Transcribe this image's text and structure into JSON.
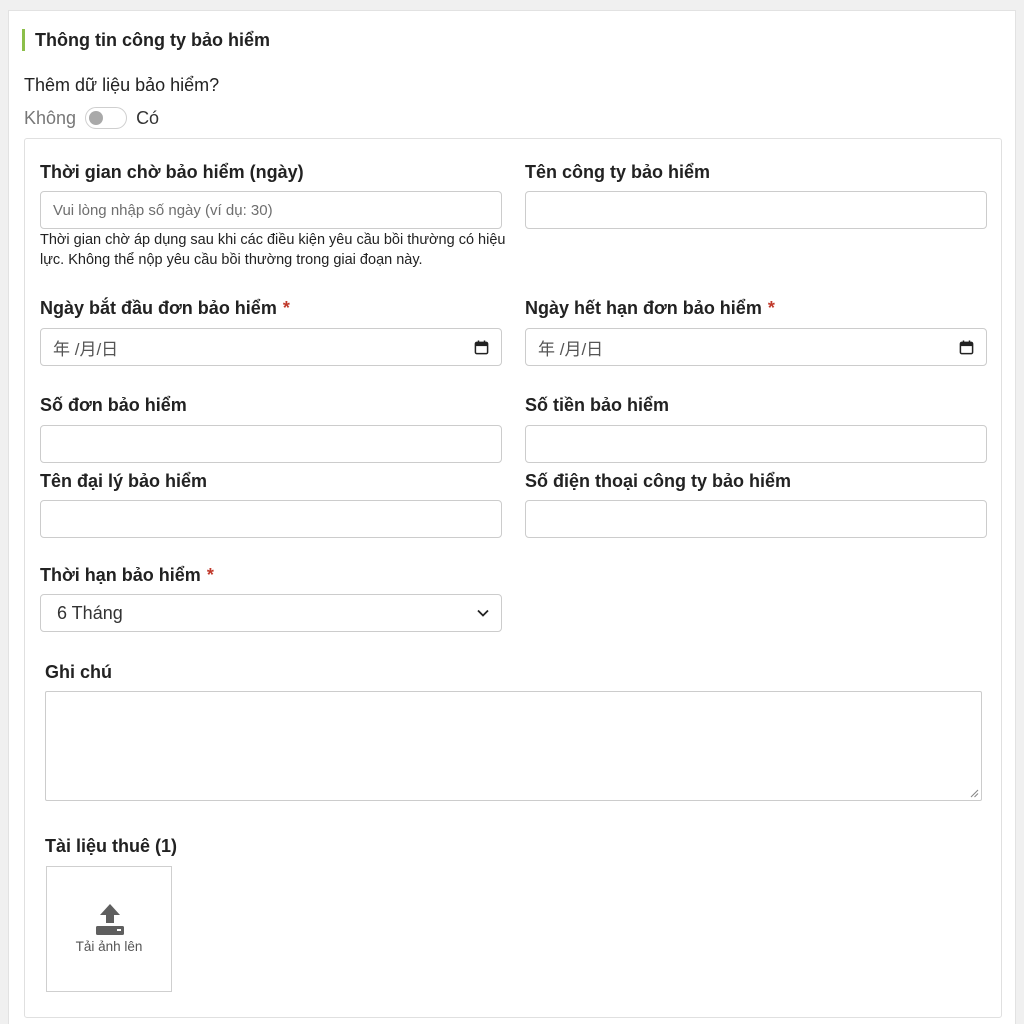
{
  "section": {
    "title": "Thông tin công ty bảo hiểm"
  },
  "toggle": {
    "question": "Thêm dữ liệu bảo hiểm?",
    "off_label": "Không",
    "on_label": "Có",
    "checked": false
  },
  "fields": {
    "waiting_period": {
      "label": "Thời gian chờ bảo hiểm (ngày)",
      "placeholder": "Vui lòng nhập số ngày (ví dụ: 30)",
      "help": "Thời gian chờ áp dụng sau khi các điều kiện yêu cầu bồi thường có hiệu lực. Không thể nộp yêu cầu bồi thường trong giai đoạn này."
    },
    "insurer_name": {
      "label": "Tên công ty bảo hiểm",
      "value": ""
    },
    "start_date": {
      "label": "Ngày bắt đầu đơn bảo hiểm",
      "required": "*",
      "display": "年 /月/日"
    },
    "end_date": {
      "label": "Ngày hết hạn đơn bảo hiểm",
      "required": "*",
      "display": "年 /月/日"
    },
    "policy_number": {
      "label": "Số đơn bảo hiểm",
      "value": ""
    },
    "coverage_amount": {
      "label": "Số tiền bảo hiểm",
      "value": ""
    },
    "agent_name": {
      "label": "Tên đại lý bảo hiểm",
      "value": ""
    },
    "insurer_phone": {
      "label": "Số điện thoại công ty bảo hiểm",
      "value": ""
    },
    "term": {
      "label": "Thời hạn bảo hiểm",
      "required": "*",
      "selected": "6 Tháng"
    },
    "notes": {
      "label": "Ghi chú",
      "value": ""
    },
    "tax_docs": {
      "label": "Tài liệu thuê (1)",
      "upload_text": "Tải ảnh lên"
    }
  },
  "colors": {
    "accent": "#8cbf4a",
    "required": "#c0392b",
    "border": "#cccccc"
  },
  "icons": [
    "calendar-icon",
    "chevron-down-icon",
    "upload-icon",
    "resize-grip-icon"
  ]
}
